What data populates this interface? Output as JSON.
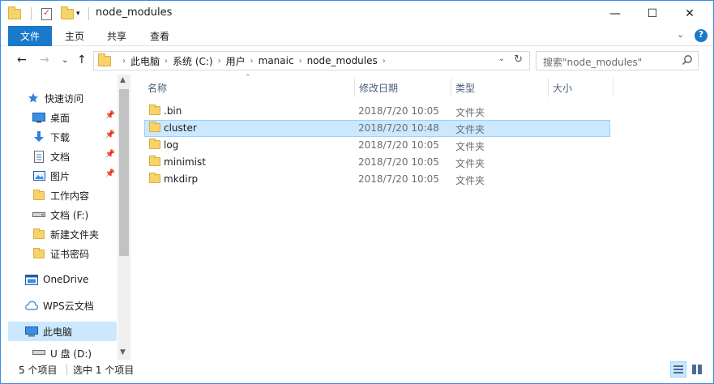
{
  "window": {
    "title": "node_modules",
    "controls": {
      "minimize": "—",
      "maximize": "☐",
      "close": "✕"
    }
  },
  "ribbon": {
    "tabs": [
      "文件",
      "主页",
      "共享",
      "查看"
    ],
    "expand_glyph": "⌄",
    "help_glyph": "?"
  },
  "navigation": {
    "back_glyph": "←",
    "forward_glyph": "→",
    "recent_glyph": "⌄",
    "up_glyph": "↑"
  },
  "address": {
    "crumbs": [
      "此电脑",
      "系统 (C:)",
      "用户",
      "manaic",
      "node_modules"
    ],
    "separator": "›"
  },
  "search": {
    "placeholder": "搜索\"node_modules\""
  },
  "sidebar": {
    "items": [
      {
        "label": "快速访问",
        "icon": "star-icon"
      },
      {
        "label": "桌面",
        "icon": "desktop-icon",
        "pinned": true
      },
      {
        "label": "下载",
        "icon": "download-icon",
        "pinned": true
      },
      {
        "label": "文档",
        "icon": "document-icon",
        "pinned": true
      },
      {
        "label": "图片",
        "icon": "picture-icon",
        "pinned": true
      },
      {
        "label": "工作内容",
        "icon": "folder-icon"
      },
      {
        "label": "文档 (F:)",
        "icon": "drive-icon"
      },
      {
        "label": "新建文件夹",
        "icon": "folder-icon"
      },
      {
        "label": "证书密码",
        "icon": "folder-icon"
      },
      {
        "label": "OneDrive",
        "icon": "onedrive-icon"
      },
      {
        "label": "WPS云文档",
        "icon": "cloud-icon"
      },
      {
        "label": "此电脑",
        "icon": "computer-icon",
        "selected": true
      },
      {
        "label": "U 盘 (D:)",
        "icon": "usb-drive-icon"
      }
    ],
    "pin_glyph": "📌"
  },
  "columns": {
    "name": "名称",
    "date": "修改日期",
    "type": "类型",
    "size": "大小"
  },
  "files": [
    {
      "name": ".bin",
      "date": "2018/7/20 10:05",
      "type": "文件夹"
    },
    {
      "name": "cluster",
      "date": "2018/7/20 10:48",
      "type": "文件夹",
      "selected": true
    },
    {
      "name": "log",
      "date": "2018/7/20 10:05",
      "type": "文件夹"
    },
    {
      "name": "minimist",
      "date": "2018/7/20 10:05",
      "type": "文件夹"
    },
    {
      "name": "mkdirp",
      "date": "2018/7/20 10:05",
      "type": "文件夹"
    }
  ],
  "status": {
    "count": "5 个项目",
    "selection": "选中 1 个项目"
  },
  "colors": {
    "accent": "#1979ca",
    "selection": "#cce8ff",
    "selection_border": "#99d1ff",
    "folder": "#f7d36b"
  }
}
